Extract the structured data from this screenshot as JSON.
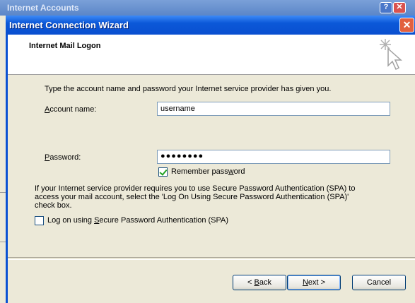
{
  "background_window": {
    "title": "Internet Accounts",
    "help_label": "?",
    "close_label": "✕"
  },
  "window": {
    "title": "Internet Connection Wizard",
    "close_label": "✕"
  },
  "header": {
    "title": "Internet Mail Logon",
    "icon": "cursor-sparkle-icon"
  },
  "form": {
    "instructions": "Type the account name and password your Internet service provider has given you.",
    "account_label_first": "A",
    "account_label_rest": "ccount name:",
    "account_value": "username",
    "password_label_first": "P",
    "password_label_rest": "assword:",
    "password_value": "●●●●●●●●",
    "remember_label_pre": "Remember pass",
    "remember_label_u": "w",
    "remember_label_post": "ord",
    "remember_checked": true,
    "spa_text": "If your Internet service provider requires you to use Secure Password Authentication (SPA) to access your mail account, select the 'Log On Using Secure Password Authentication (SPA)' check box.",
    "spa_label_pre": "Log on using ",
    "spa_label_u": "S",
    "spa_label_post": "ecure Password Authentication (SPA)",
    "spa_checked": false
  },
  "buttons": {
    "back_pre": "< ",
    "back_u": "B",
    "back_post": "ack",
    "next_u": "N",
    "next_post": "ext >",
    "cancel": "Cancel"
  },
  "colors": {
    "titlebar": "#0a52d3",
    "close": "#e2603f",
    "dialog_bg": "#ece9d8"
  }
}
